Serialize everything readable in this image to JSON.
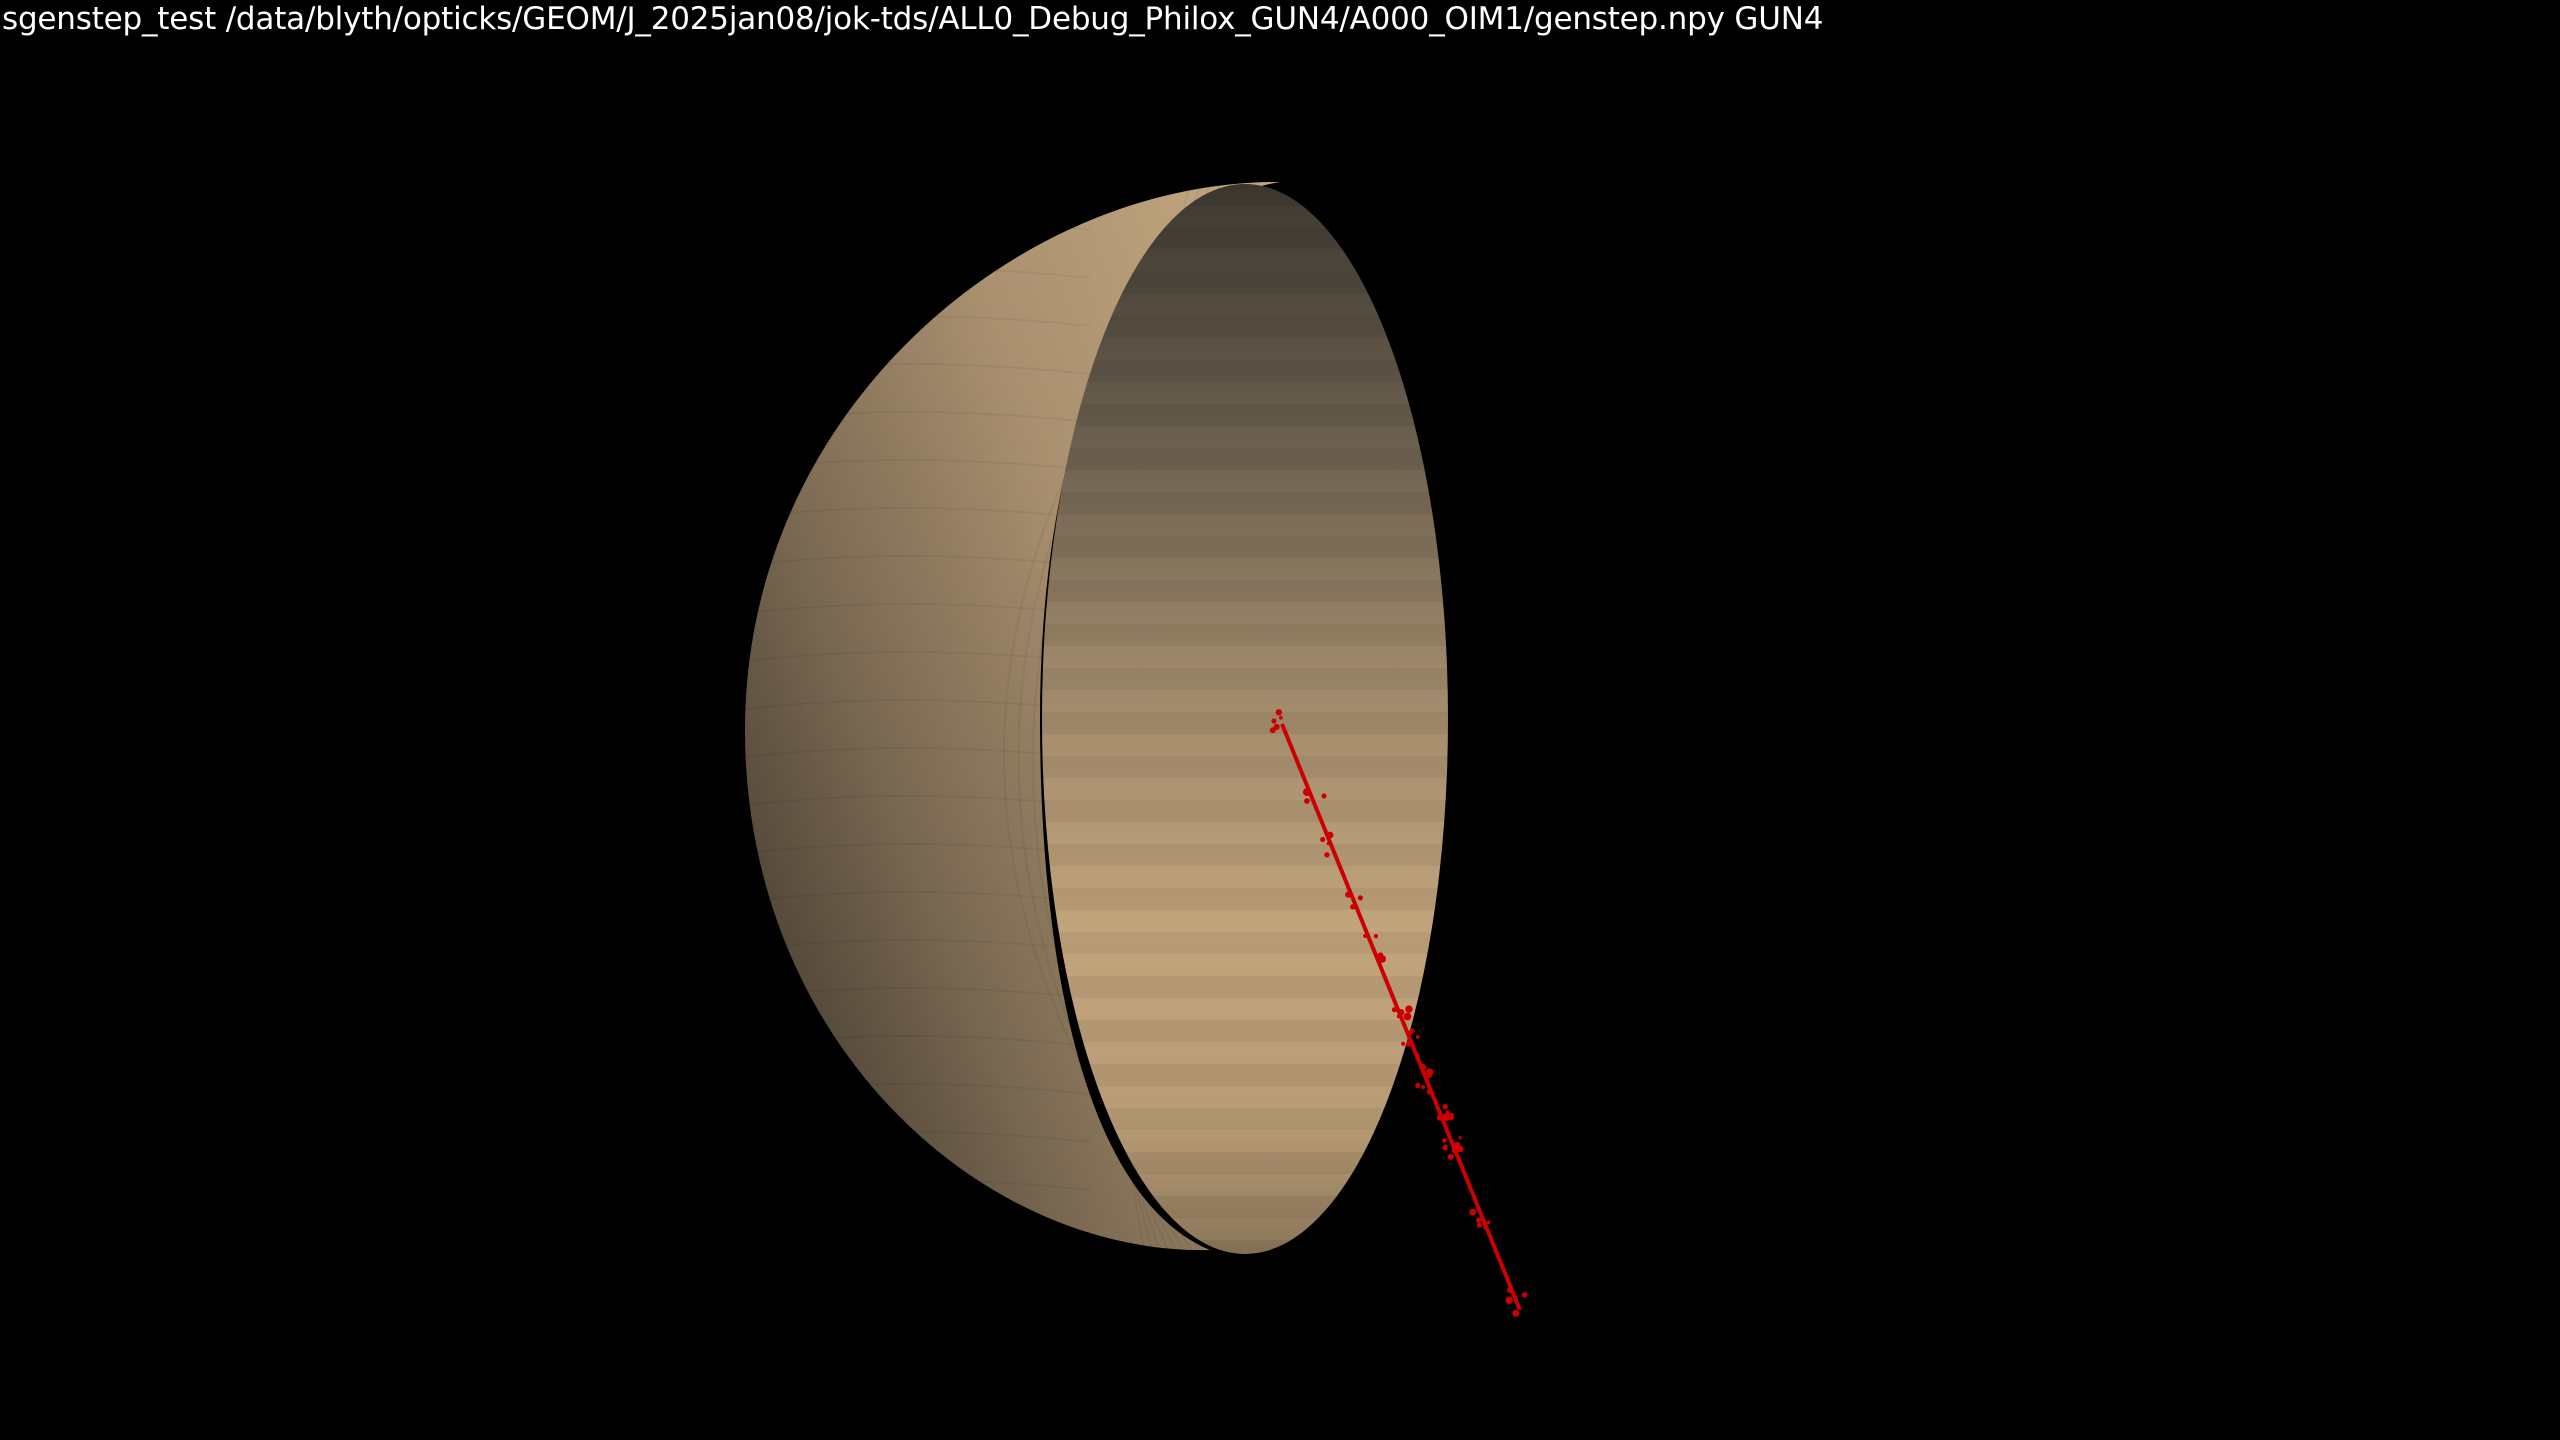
{
  "window": {
    "title": "sgenstep_test /data/blyth/opticks/GEOM/J_2025jan08/jok-tds/ALL0_Debug_Philox_GUN4/A000_OIM1/genstep.npy GUN4"
  },
  "scene": {
    "background_color": "#000000",
    "hemisphere": {
      "outer_color": "#b79d7b",
      "inner_color": "#c6a77e",
      "shadow_color": "#3f3a33"
    },
    "track": {
      "color": "#cc0000",
      "description_icon": "genstep-track-icon"
    }
  }
}
